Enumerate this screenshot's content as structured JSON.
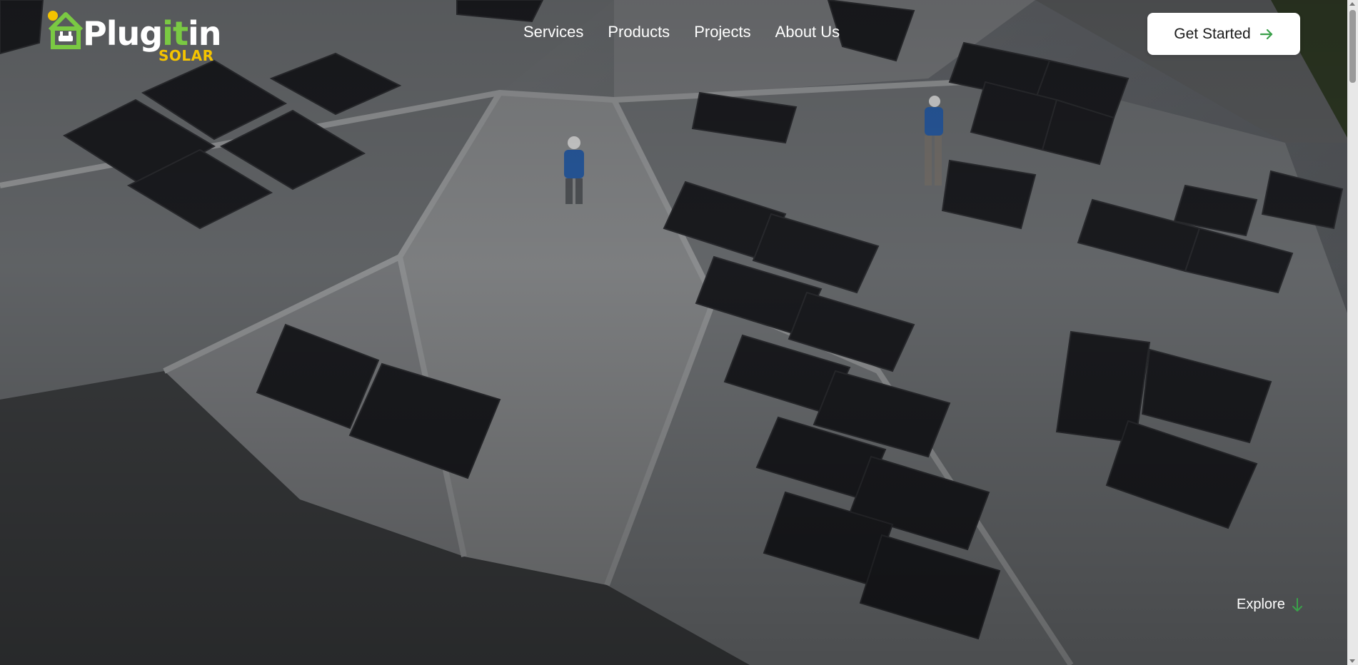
{
  "logo": {
    "brand_prefix": "Plug",
    "brand_highlight": "it",
    "brand_suffix": "in",
    "sub": "SOLAR",
    "colors": {
      "green": "#7ac943",
      "yellow": "#f4c400"
    }
  },
  "nav": {
    "items": [
      {
        "label": "Services"
      },
      {
        "label": "Products"
      },
      {
        "label": "Projects"
      },
      {
        "label": "About Us"
      }
    ]
  },
  "cta": {
    "label": "Get Started",
    "icon": "arrow-right-icon",
    "icon_color": "#3aa04a"
  },
  "explore": {
    "label": "Explore",
    "icon": "arrow-down-icon",
    "icon_color": "#3aa04a"
  },
  "hero": {
    "image": "aerial-roof-solar-installation"
  }
}
